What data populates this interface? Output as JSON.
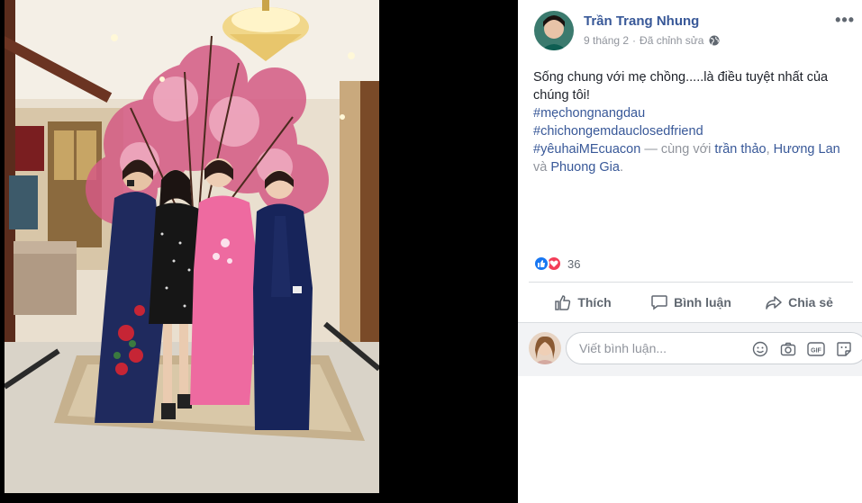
{
  "post": {
    "author": "Trần Trang Nhung",
    "date": "9 tháng 2",
    "separator": "·",
    "edited": "Đã chỉnh sửa",
    "more": "•••",
    "text_line1": "Sống chung với mẹ chồng.....là điều tuyệt nhất của chúng tôi!",
    "hashtags": [
      "#mẹchongnangdau",
      "#chichongemdauclosedfriend"
    ],
    "hashtag_last": "#yêuhaiMEcuacon",
    "with_text": " — cùng với ",
    "person1": "trần thảo",
    "comma": ", ",
    "person2": "Hương Lan",
    "and_text": " và ",
    "person3": "Phuong Gia",
    "period": "."
  },
  "reactions": {
    "count": "36",
    "icons": [
      "like-icon",
      "love-icon"
    ]
  },
  "actions": {
    "like": "Thích",
    "comment": "Bình luận",
    "share": "Chia sẻ"
  },
  "comment_box": {
    "placeholder": "Viết bình luận...",
    "icons": [
      "emoji-icon",
      "camera-icon",
      "gif-icon",
      "sticker-icon"
    ]
  },
  "colors": {
    "link": "#385898",
    "meta": "#90949c",
    "text": "#1d2129",
    "like_blue": "#1877f2",
    "love_red": "#f33e58"
  }
}
